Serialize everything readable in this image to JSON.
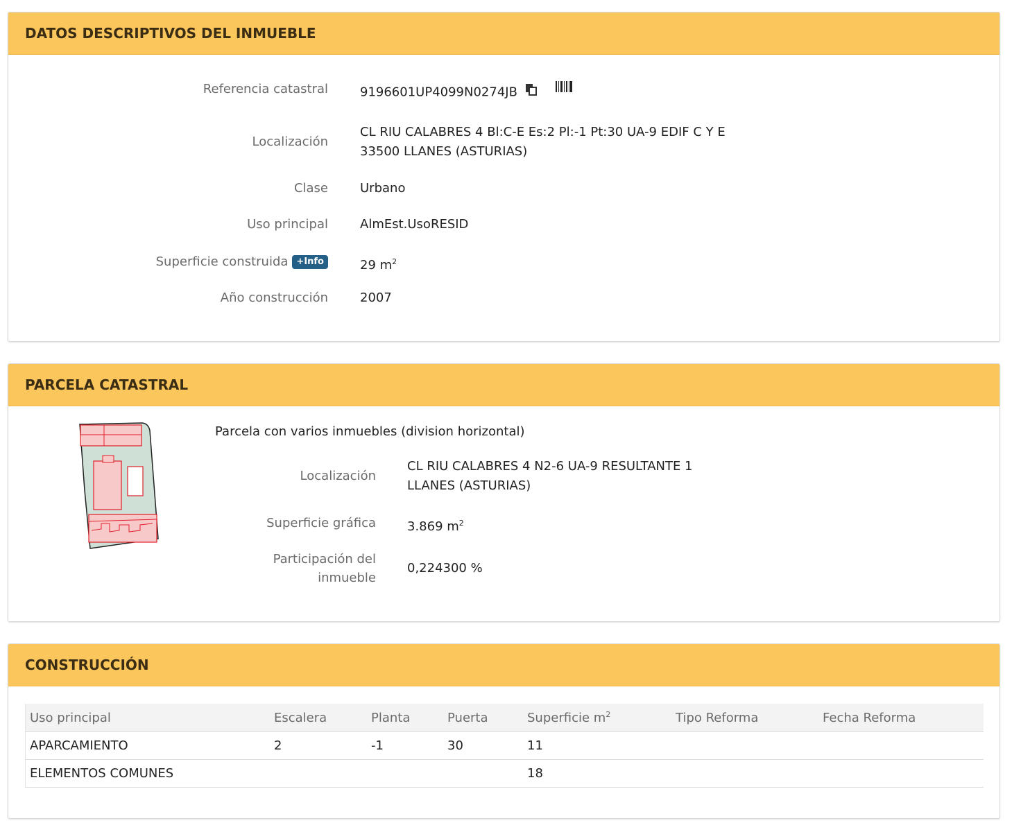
{
  "datos": {
    "title": "DATOS DESCRIPTIVOS DEL INMUEBLE",
    "referencia_label": "Referencia catastral",
    "referencia_value": "9196601UP4099N0274JB",
    "localizacion_label": "Localización",
    "localizacion_line1": "CL RIU CALABRES 4 Bl:C-E Es:2 Pl:-1 Pt:30 UA-9 EDIF C Y E",
    "localizacion_line2": "33500 LLANES (ASTURIAS)",
    "clase_label": "Clase",
    "clase_value": "Urbano",
    "uso_label": "Uso principal",
    "uso_value": "AlmEst.UsoRESID",
    "superficie_label": "Superficie construida",
    "info_badge": "+Info",
    "superficie_value": "29 m",
    "superficie_unit_sup": "2",
    "anio_label": "Año construcción",
    "anio_value": "2007"
  },
  "parcela": {
    "title": "PARCELA CATASTRAL",
    "descripcion": "Parcela con varios inmuebles (division horizontal)",
    "localizacion_label": "Localización",
    "localizacion_line1": "CL RIU CALABRES 4 N2-6 UA-9 RESULTANTE 1",
    "localizacion_line2": "LLANES (ASTURIAS)",
    "superficie_label": "Superficie gráfica",
    "superficie_value": "3.869 m",
    "superficie_unit_sup": "2",
    "participacion_label_line1": "Participación del",
    "participacion_label_line2": "inmueble",
    "participacion_value": "0,224300 %"
  },
  "construccion": {
    "title": "CONSTRUCCIÓN",
    "headers": {
      "uso": "Uso principal",
      "escalera": "Escalera",
      "planta": "Planta",
      "puerta": "Puerta",
      "superficie": "Superficie m",
      "superficie_sup": "2",
      "tipo_reforma": "Tipo Reforma",
      "fecha_reforma": "Fecha Reforma"
    },
    "rows": [
      {
        "uso": "APARCAMIENTO",
        "escalera": "2",
        "planta": "-1",
        "puerta": "30",
        "superficie": "11",
        "tipo_reforma": "",
        "fecha_reforma": ""
      },
      {
        "uso": "ELEMENTOS COMUNES",
        "escalera": "",
        "planta": "",
        "puerta": "",
        "superficie": "18",
        "tipo_reforma": "",
        "fecha_reforma": ""
      }
    ]
  },
  "colors": {
    "header_bg": "#fbc65c",
    "info_badge_bg": "#245f88",
    "parcel_fill": "#cfe0d6",
    "parcel_building": "#f7c9c9",
    "parcel_line": "#e0202a"
  },
  "icons": [
    "copy-icon",
    "barcode-icon",
    "parcel-map-thumbnail"
  ]
}
